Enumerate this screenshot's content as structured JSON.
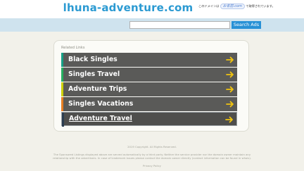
{
  "site": {
    "domain_title": "lhuna-adventure.com",
    "jp_note_prefix": "このドメインは",
    "jp_logo_text": "お名前.com",
    "jp_note_suffix": "で取得されています。"
  },
  "search": {
    "value": "",
    "button_label": "Search Ads"
  },
  "related": {
    "heading": "Related Links",
    "items": [
      {
        "label": "Black Singles",
        "stripe": "#16a085"
      },
      {
        "label": "Singles Travel",
        "stripe": "#27ae60"
      },
      {
        "label": "Adventure Trips",
        "stripe": "#cdd100"
      },
      {
        "label": "Singles Vacations",
        "stripe": "#e67e22"
      },
      {
        "label": "Adventure Travel",
        "stripe": "#2c3e50"
      }
    ],
    "arrow_color": "#f1c40f",
    "arrow_icon": "right-arrow-icon"
  },
  "footer": {
    "copyright": "2019 Copyright. All Rights Reserved.",
    "disclaimer_line1": "The Sponsored Listings displayed above are served automatically by a third party. Neither the service provider nor the domain owner maintain any",
    "disclaimer_line2": "relationship with the advertisers. In case of trademark issues please contact the domain owner directly (contact information can be found in whois).",
    "privacy_link": "Privacy Policy"
  }
}
